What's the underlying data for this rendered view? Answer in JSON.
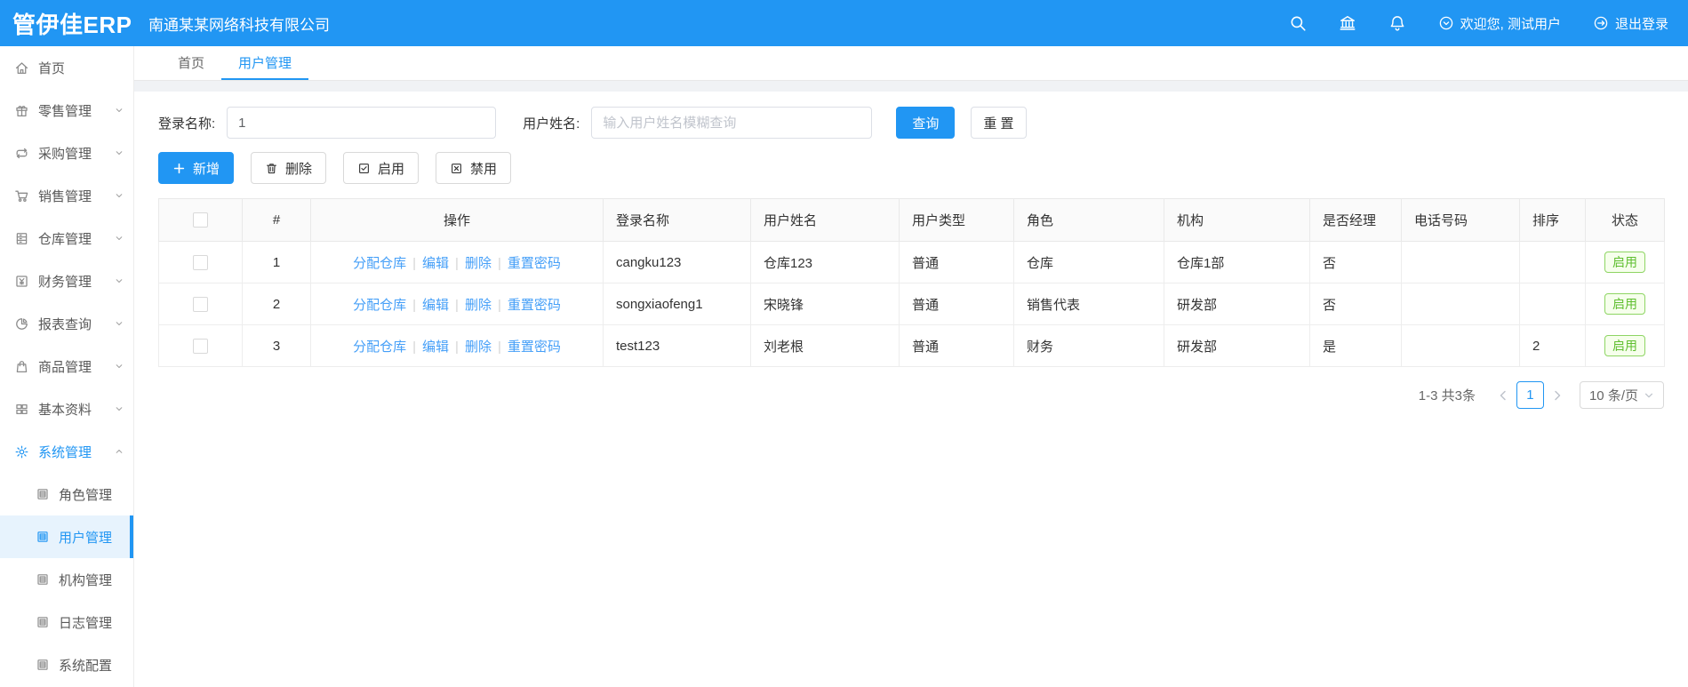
{
  "colors": {
    "header_bg": "#2196F3",
    "accent": "#2196F3",
    "link": "#459FF8",
    "badge_green": "#5FBE2F",
    "selected_menu_bg": "#E7F3FD"
  },
  "header": {
    "logo": "管伊佳ERP",
    "company": "南通某某网络科技有限公司",
    "icons": [
      "search-icon",
      "bank-icon",
      "bell-icon"
    ],
    "welcome": "欢迎您, 测试用户",
    "logout": "退出登录"
  },
  "sidebar": {
    "items": [
      {
        "label": "首页",
        "icon": "home-icon",
        "expandable": false
      },
      {
        "label": "零售管理",
        "icon": "retail-icon",
        "expandable": true
      },
      {
        "label": "采购管理",
        "icon": "purchase-icon",
        "expandable": true
      },
      {
        "label": "销售管理",
        "icon": "sales-cart-icon",
        "expandable": true
      },
      {
        "label": "仓库管理",
        "icon": "warehouse-icon",
        "expandable": true
      },
      {
        "label": "财务管理",
        "icon": "finance-icon",
        "expandable": true
      },
      {
        "label": "报表查询",
        "icon": "report-pie-icon",
        "expandable": true
      },
      {
        "label": "商品管理",
        "icon": "goods-bag-icon",
        "expandable": true
      },
      {
        "label": "基本资料",
        "icon": "basedata-grid-icon",
        "expandable": true
      },
      {
        "label": "系统管理",
        "icon": "system-gear-icon",
        "expandable": true,
        "expanded": true,
        "active_parent": true,
        "children": [
          {
            "label": "角色管理",
            "selected": false
          },
          {
            "label": "用户管理",
            "selected": true
          },
          {
            "label": "机构管理",
            "selected": false
          },
          {
            "label": "日志管理",
            "selected": false
          },
          {
            "label": "系统配置",
            "selected": false
          }
        ]
      }
    ]
  },
  "tabs": [
    {
      "label": "首页",
      "active": false
    },
    {
      "label": "用户管理",
      "active": true
    }
  ],
  "filters": {
    "login_name_label": "登录名称:",
    "login_name_value": "1",
    "user_name_label": "用户姓名:",
    "user_name_placeholder": "输入用户姓名模糊查询",
    "search_button": "查询",
    "reset_button": "重 置"
  },
  "toolbar": {
    "add": "新增",
    "delete": "删除",
    "enable": "启用",
    "disable": "禁用"
  },
  "table": {
    "columns": [
      "",
      "#",
      "操作",
      "登录名称",
      "用户姓名",
      "用户类型",
      "角色",
      "机构",
      "是否经理",
      "电话号码",
      "排序",
      "状态"
    ],
    "action_links": [
      "分配仓库",
      "编辑",
      "删除",
      "重置密码"
    ],
    "rows": [
      {
        "index": "1",
        "login_name": "cangku123",
        "user_name": "仓库123",
        "user_type": "普通",
        "role": "仓库",
        "org": "仓库1部",
        "is_manager": "否",
        "phone": "",
        "sort": "",
        "status": "启用"
      },
      {
        "index": "2",
        "login_name": "songxiaofeng1",
        "user_name": "宋晓锋",
        "user_type": "普通",
        "role": "销售代表",
        "org": "研发部",
        "is_manager": "否",
        "phone": "",
        "sort": "",
        "status": "启用"
      },
      {
        "index": "3",
        "login_name": "test123",
        "user_name": "刘老根",
        "user_type": "普通",
        "role": "财务",
        "org": "研发部",
        "is_manager": "是",
        "phone": "",
        "sort": "2",
        "status": "启用"
      }
    ]
  },
  "pagination": {
    "total_text": "1-3 共3条",
    "current_page": "1",
    "page_size": "10 条/页"
  }
}
